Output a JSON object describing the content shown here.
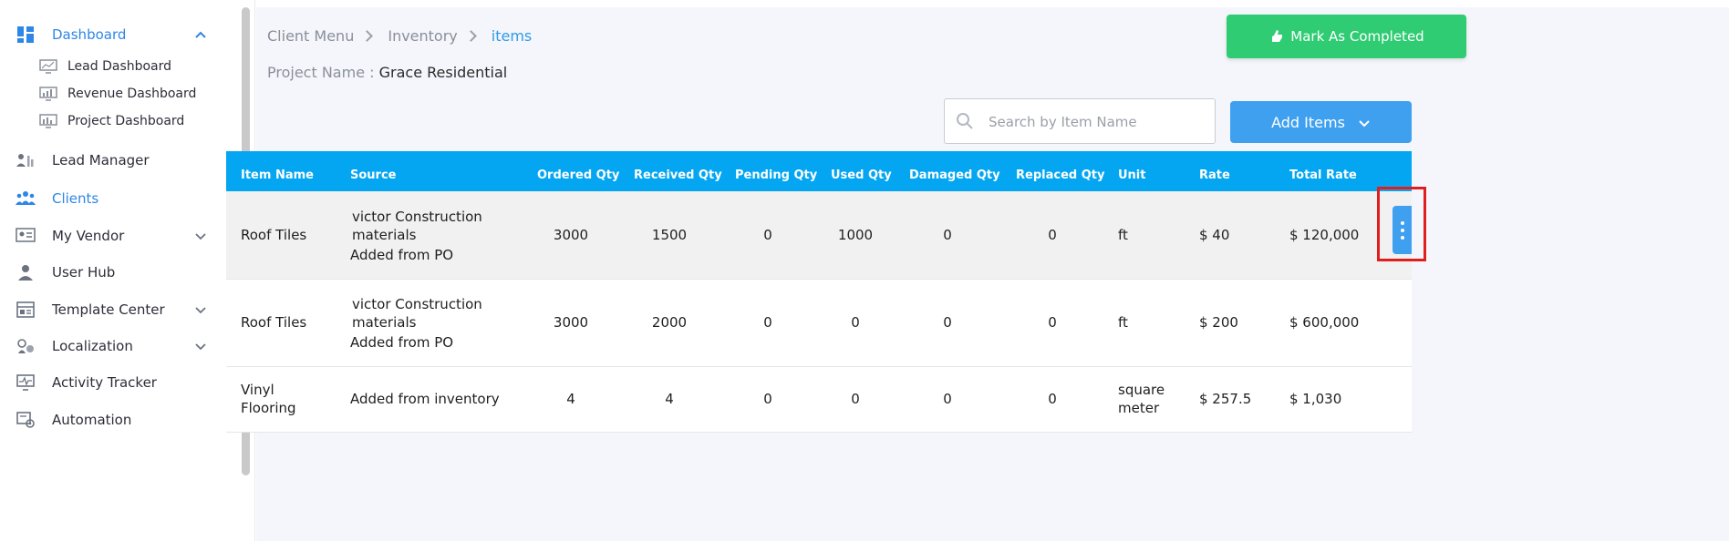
{
  "sidebar": {
    "dashboard": {
      "label": "Dashboard"
    },
    "sub_items": [
      {
        "label": "Lead Dashboard"
      },
      {
        "label": "Revenue Dashboard"
      },
      {
        "label": "Project Dashboard"
      }
    ],
    "items": [
      {
        "label": "Lead Manager"
      },
      {
        "label": "Clients"
      },
      {
        "label": "My Vendor"
      },
      {
        "label": "User Hub"
      },
      {
        "label": "Template Center"
      },
      {
        "label": "Localization"
      },
      {
        "label": "Activity Tracker"
      },
      {
        "label": "Automation"
      }
    ]
  },
  "breadcrumb": [
    "Client Menu",
    "Inventory",
    "items"
  ],
  "project": {
    "label": "Project Name :",
    "value": "Grace Residential"
  },
  "actions": {
    "mark_completed": "Mark As Completed",
    "add_items": "Add Items"
  },
  "search": {
    "placeholder": "Search by Item Name"
  },
  "table": {
    "headers": [
      "Item Name",
      "Source",
      "Ordered Qty",
      "Received Qty",
      "Pending Qty",
      "Used Qty",
      "Damaged Qty",
      "Replaced Qty",
      "Unit",
      "Rate",
      "Total Rate"
    ],
    "rows": [
      {
        "item": "Roof Tiles",
        "source_line1": "victor Construction",
        "source_line2": "materials",
        "source_line3": "Added from PO",
        "ordered": "3000",
        "received": "1500",
        "pending": "0",
        "used": "1000",
        "damaged": "0",
        "replaced": "0",
        "unit": "ft",
        "rate": "$ 40",
        "total": "$ 120,000"
      },
      {
        "item": "Roof Tiles",
        "source_line1": "victor Construction",
        "source_line2": "materials",
        "source_line3": "Added from PO",
        "ordered": "3000",
        "received": "2000",
        "pending": "0",
        "used": "0",
        "damaged": "0",
        "replaced": "0",
        "unit": "ft",
        "rate": "$ 200",
        "total": "$ 600,000"
      },
      {
        "item_line1": "Vinyl",
        "item_line2": "Flooring",
        "source": "Added from inventory",
        "ordered": "4",
        "received": "4",
        "pending": "0",
        "used": "0",
        "damaged": "0",
        "replaced": "0",
        "unit_line1": "square",
        "unit_line2": "meter",
        "rate": "$ 257.5",
        "total": "$ 1,030"
      }
    ]
  },
  "colors": {
    "accent": "#2e86e6",
    "header": "#04a6f2",
    "success": "#2fcc73",
    "highlight": "#e01e1e"
  }
}
